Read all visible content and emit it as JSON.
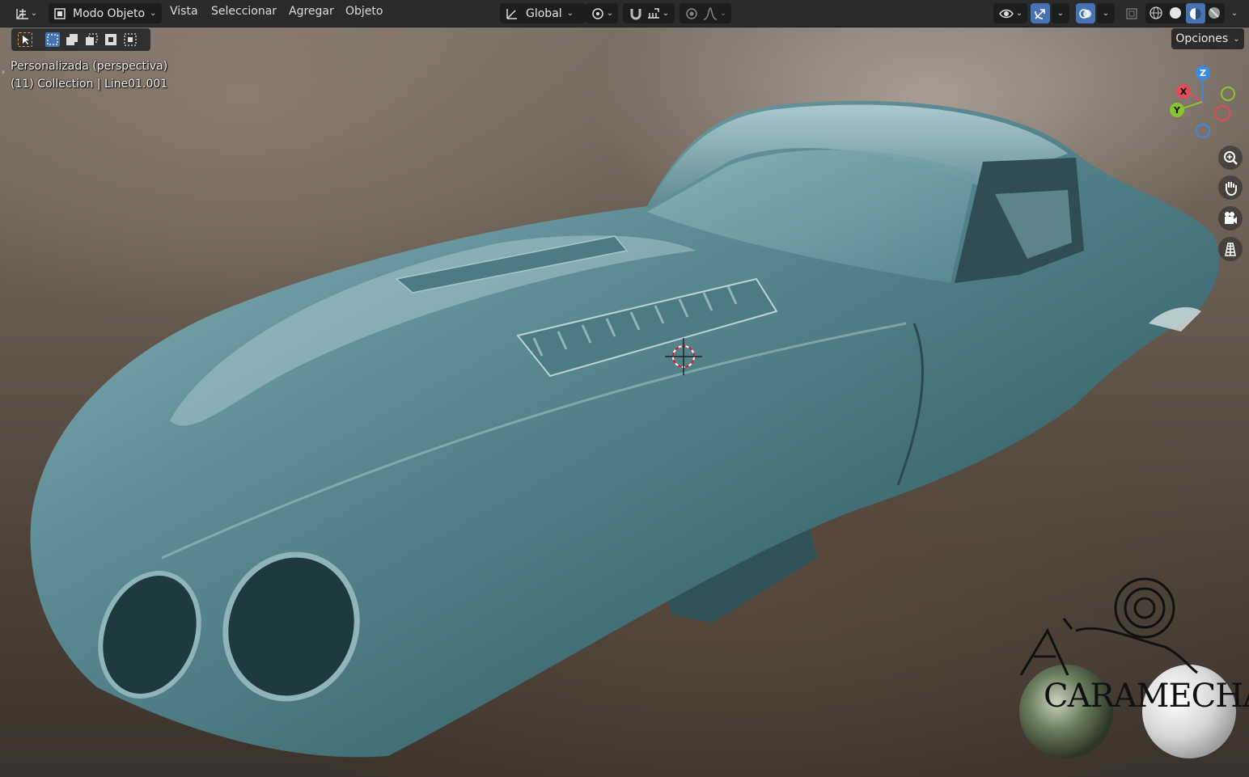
{
  "header": {
    "editor_type_icon": "axes-grid-icon",
    "mode_label": "Modo Objeto",
    "menu": [
      "Vista",
      "Seleccionar",
      "Agregar",
      "Objeto"
    ],
    "transform_orientation": "Global"
  },
  "toolbar": {
    "options_label": "Opciones"
  },
  "viewport": {
    "view_name": "Personalizada (perspectiva)",
    "collection_info": "(11) Collection | Line01.001"
  },
  "gizmo": {
    "axes": [
      "Z",
      "X",
      "Y"
    ]
  },
  "watermark": {
    "text": "CARAMECHA"
  },
  "colors": {
    "header_bg": "#2b2b2b",
    "accent_blue": "#4772b3",
    "axis_x": "#e04b5c",
    "axis_y": "#86c530",
    "axis_z": "#3d8be0",
    "car_body": "#4f7d86"
  }
}
